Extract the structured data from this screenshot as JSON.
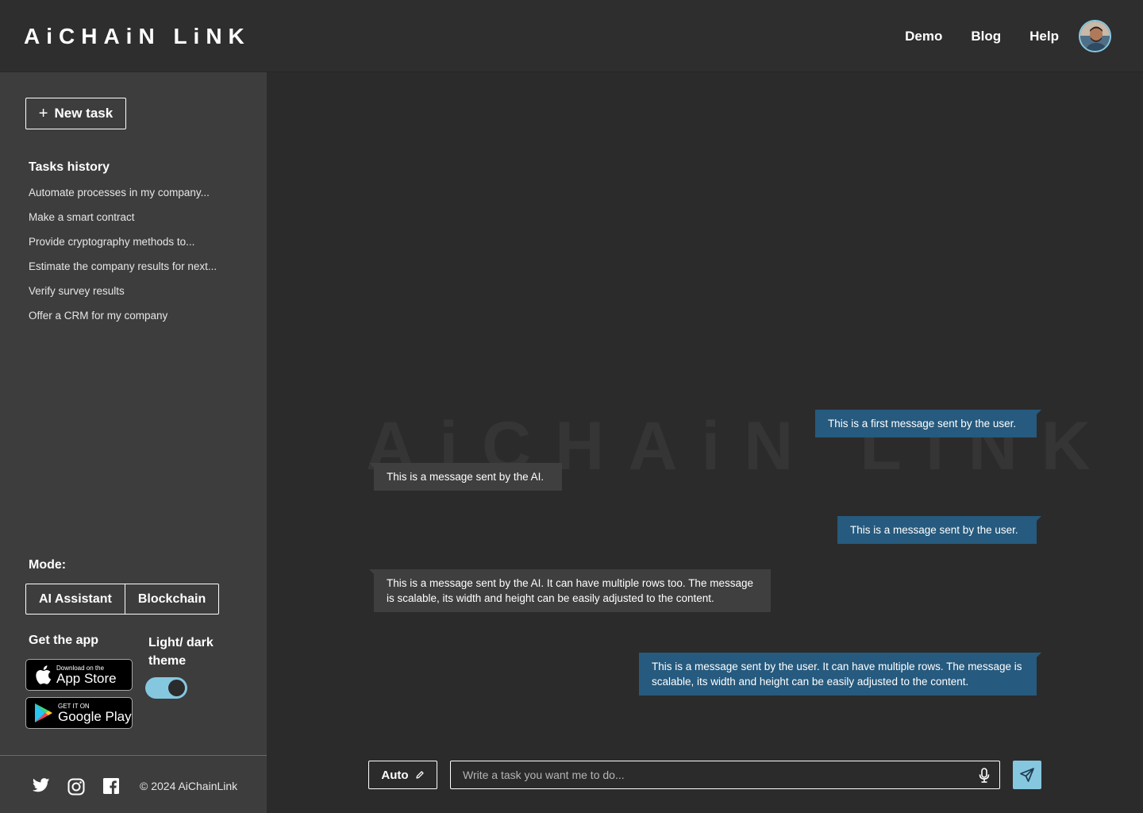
{
  "header": {
    "logo_text": "AiCHAiN LiNK",
    "nav": [
      {
        "label": "Demo"
      },
      {
        "label": "Blog"
      },
      {
        "label": "Help"
      }
    ]
  },
  "sidebar": {
    "new_task_label": "New task",
    "history_title": "Tasks history",
    "history": [
      "Automate processes in my company...",
      "Make a smart contract",
      "Provide cryptography methods to...",
      "Estimate the company results for next...",
      "Verify survey results",
      "Offer a CRM for my company"
    ],
    "mode_label": "Mode:",
    "modes": [
      "AI Assistant",
      "Blockchain"
    ],
    "get_app_label": "Get the app",
    "app_store": {
      "small": "Download on the",
      "big": "App Store"
    },
    "google_play": {
      "small": "GET IT ON",
      "big": "Google Play"
    },
    "theme_label": "Light/ dark theme",
    "theme_toggle_on": true,
    "copyright": "© 2024 AiChainLink"
  },
  "chat": {
    "watermark": "AiCHAiN LiNK",
    "messages": [
      {
        "from": "user",
        "text": "This is a first message sent by the user."
      },
      {
        "from": "ai",
        "text": "This is a message sent by the AI."
      },
      {
        "from": "user",
        "text": "This is a message sent by the user."
      },
      {
        "from": "ai",
        "text": "This is a message sent by the AI. It can have multiple rows too. The message is scalable, its width and height can be easily adjusted to the content."
      },
      {
        "from": "user",
        "text": "This is a message sent by the user. It can have multiple rows. The message is scalable, its width and height can be easily adjusted to the content."
      }
    ]
  },
  "composer": {
    "auto_label": "Auto",
    "placeholder": "Write a task you want me to do...",
    "value": ""
  },
  "colors": {
    "accent": "#86c7e0",
    "user_bubble": "#265a7e",
    "ai_bubble": "#3f3f3f",
    "sidebar_bg": "#3d3d3d",
    "page_bg": "#2b2b2b"
  },
  "icons": [
    "plus-icon",
    "apple-icon",
    "google-play-icon",
    "twitter-icon",
    "instagram-icon",
    "facebook-icon",
    "pencil-icon",
    "microphone-icon",
    "send-icon"
  ]
}
